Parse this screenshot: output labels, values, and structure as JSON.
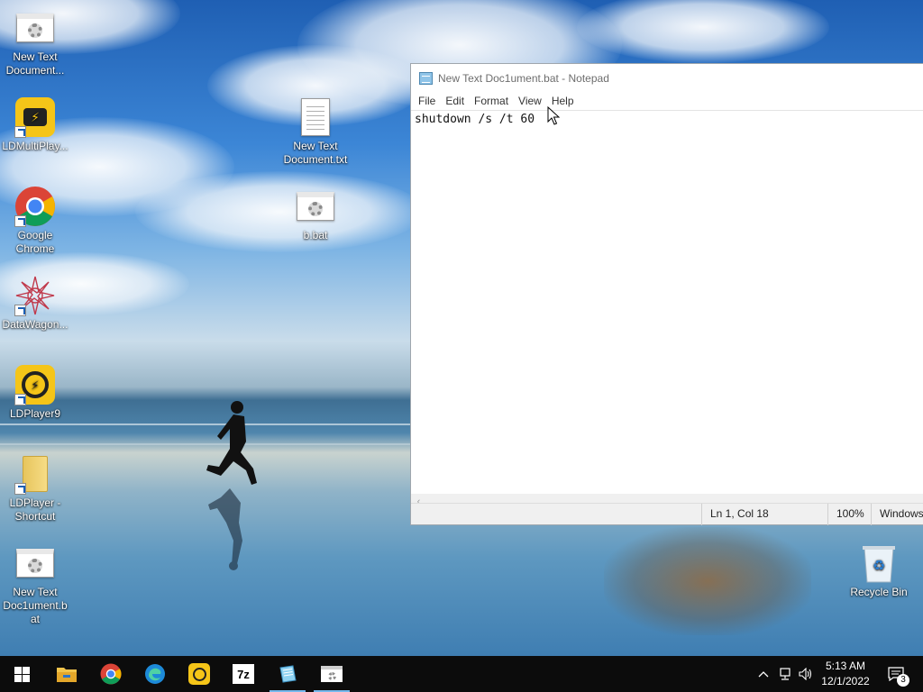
{
  "desktop_icons": [
    {
      "label": "New Text Document...",
      "type": "bat"
    },
    {
      "label": "LDMultiPlay...",
      "type": "ldmulti"
    },
    {
      "label": "Google Chrome",
      "type": "chrome"
    },
    {
      "label": "DataWagon...",
      "type": "datawagon"
    },
    {
      "label": "LDPlayer9",
      "type": "ldplayer"
    },
    {
      "label": "LDPlayer - Shortcut",
      "type": "folder"
    },
    {
      "label": "New Text Doc1ument.b at",
      "type": "bat"
    },
    {
      "label": "New Text Document.txt",
      "type": "txt"
    },
    {
      "label": "b.bat",
      "type": "bat"
    },
    {
      "label": "Recycle Bin",
      "type": "recycle"
    }
  ],
  "notepad": {
    "title": "New Text Doc1ument.bat - Notepad",
    "menu": [
      "File",
      "Edit",
      "Format",
      "View",
      "Help"
    ],
    "content": "shutdown /s /t 60",
    "status": {
      "position": "Ln 1, Col 18",
      "zoom": "100%",
      "line_ending": "Windows (CRLF)"
    }
  },
  "taskbar": {
    "apps": [
      "start-windows-icon",
      "file-explorer-icon",
      "chrome-icon",
      "edge-icon",
      "ldplayer-icon",
      "7zip-icon",
      "notepad-icon",
      "bat-file-icon"
    ],
    "tray": {
      "time": "5:13 AM",
      "date": "12/1/2022",
      "notification_count": "3"
    }
  },
  "colors": {
    "taskbar_bg": "#0c0c0c",
    "active_indicator": "#76b9ed",
    "chrome_red": "#db4437",
    "chrome_yellow": "#f4b400",
    "chrome_green": "#0f9d58",
    "chrome_blue": "#4285f4",
    "ldplayer_yellow": "#f5c518"
  }
}
